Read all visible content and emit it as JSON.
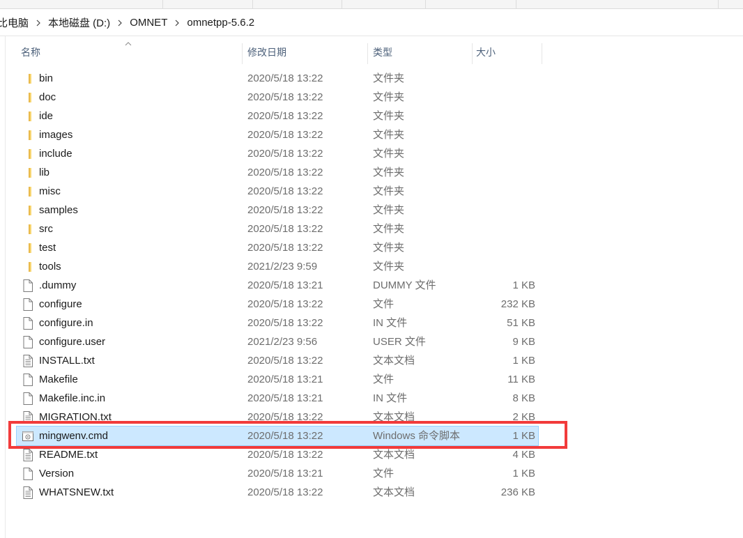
{
  "window": {
    "address_bar": {
      "breadcrumbs": [
        "比电脑",
        "本地磁盘 (D:)",
        "OMNET",
        "omnetpp-5.6.2"
      ]
    }
  },
  "file_list": {
    "columns": {
      "name": "名称",
      "modified": "修改日期",
      "type": "类型",
      "size": "大小"
    },
    "rows": [
      {
        "name": "bin",
        "modified": "2020/5/18 13:22",
        "type": "文件夹",
        "size": "",
        "icon": "folder-icon"
      },
      {
        "name": "doc",
        "modified": "2020/5/18 13:22",
        "type": "文件夹",
        "size": "",
        "icon": "folder-icon"
      },
      {
        "name": "ide",
        "modified": "2020/5/18 13:22",
        "type": "文件夹",
        "size": "",
        "icon": "folder-icon"
      },
      {
        "name": "images",
        "modified": "2020/5/18 13:22",
        "type": "文件夹",
        "size": "",
        "icon": "folder-icon"
      },
      {
        "name": "include",
        "modified": "2020/5/18 13:22",
        "type": "文件夹",
        "size": "",
        "icon": "folder-icon"
      },
      {
        "name": "lib",
        "modified": "2020/5/18 13:22",
        "type": "文件夹",
        "size": "",
        "icon": "folder-icon"
      },
      {
        "name": "misc",
        "modified": "2020/5/18 13:22",
        "type": "文件夹",
        "size": "",
        "icon": "folder-icon"
      },
      {
        "name": "samples",
        "modified": "2020/5/18 13:22",
        "type": "文件夹",
        "size": "",
        "icon": "folder-icon"
      },
      {
        "name": "src",
        "modified": "2020/5/18 13:22",
        "type": "文件夹",
        "size": "",
        "icon": "folder-icon"
      },
      {
        "name": "test",
        "modified": "2020/5/18 13:22",
        "type": "文件夹",
        "size": "",
        "icon": "folder-icon"
      },
      {
        "name": "tools",
        "modified": "2021/2/23 9:59",
        "type": "文件夹",
        "size": "",
        "icon": "folder-icon"
      },
      {
        "name": ".dummy",
        "modified": "2020/5/18 13:21",
        "type": "DUMMY 文件",
        "size": "1 KB",
        "icon": "file-icon"
      },
      {
        "name": "configure",
        "modified": "2020/5/18 13:22",
        "type": "文件",
        "size": "232 KB",
        "icon": "file-icon"
      },
      {
        "name": "configure.in",
        "modified": "2020/5/18 13:22",
        "type": "IN 文件",
        "size": "51 KB",
        "icon": "file-icon"
      },
      {
        "name": "configure.user",
        "modified": "2021/2/23 9:56",
        "type": "USER 文件",
        "size": "9 KB",
        "icon": "file-icon"
      },
      {
        "name": "INSTALL.txt",
        "modified": "2020/5/18 13:22",
        "type": "文本文档",
        "size": "1 KB",
        "icon": "text-file-icon"
      },
      {
        "name": "Makefile",
        "modified": "2020/5/18 13:21",
        "type": "文件",
        "size": "11 KB",
        "icon": "file-icon"
      },
      {
        "name": "Makefile.inc.in",
        "modified": "2020/5/18 13:21",
        "type": "IN 文件",
        "size": "8 KB",
        "icon": "file-icon"
      },
      {
        "name": "MIGRATION.txt",
        "modified": "2020/5/18 13:22",
        "type": "文本文档",
        "size": "2 KB",
        "icon": "text-file-icon"
      },
      {
        "name": "mingwenv.cmd",
        "modified": "2020/5/18 13:22",
        "type": "Windows 命令脚本",
        "size": "1 KB",
        "icon": "cmd-script-icon",
        "selected": true
      },
      {
        "name": "README.txt",
        "modified": "2020/5/18 13:22",
        "type": "文本文档",
        "size": "4 KB",
        "icon": "text-file-icon"
      },
      {
        "name": "Version",
        "modified": "2020/5/18 13:21",
        "type": "文件",
        "size": "1 KB",
        "icon": "file-icon"
      },
      {
        "name": "WHATSNEW.txt",
        "modified": "2020/5/18 13:22",
        "type": "文本文档",
        "size": "236 KB",
        "icon": "text-file-icon"
      }
    ]
  },
  "colors": {
    "selection_bg": "#cce8ff",
    "selection_border": "#99d1ff",
    "annotation_box": "#f23b3b",
    "folder_yellow": "#f8d775",
    "secondary_text": "#6d6d6d",
    "header_text": "#4c607a"
  }
}
